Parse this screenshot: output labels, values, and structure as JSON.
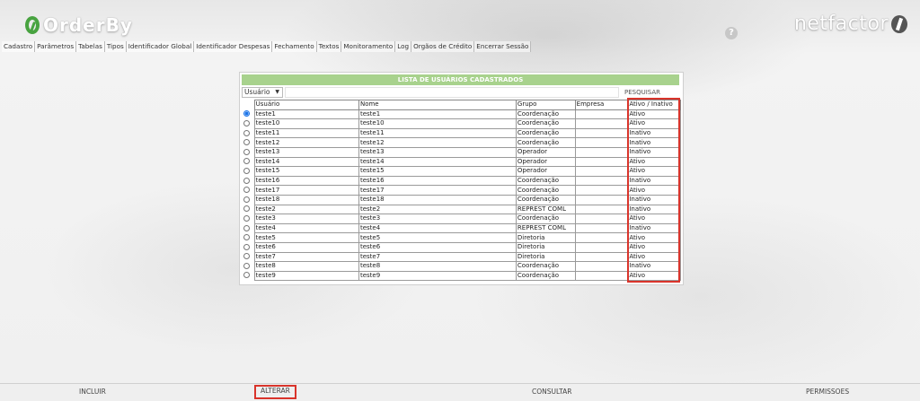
{
  "header": {
    "logo_left": "OrderBy",
    "logo_right": "netfactor",
    "help_glyph": "?"
  },
  "menu": [
    "Cadastro",
    "Parâmetros",
    "Tabelas",
    "Tipos",
    "Identificador Global",
    "Identificador Despesas",
    "Fechamento",
    "Textos",
    "Monitoramento",
    "Log",
    "Orgãos de Crédito",
    "Encerrar Sessão"
  ],
  "panel": {
    "title": "LISTA DE USUÁRIOS CADASTRADOS",
    "search": {
      "field_selected": "Usuário",
      "input_value": "",
      "button_label": "PESQUISAR"
    },
    "columns": [
      "Usuário",
      "Nome",
      "Grupo",
      "Empresa",
      "Ativo / Inativo"
    ],
    "rows": [
      {
        "usuario": "teste1",
        "nome": "teste1",
        "grupo": "Coordenação",
        "empresa": "",
        "status": "Ativo",
        "selected": true
      },
      {
        "usuario": "teste10",
        "nome": "teste10",
        "grupo": "Coordenação",
        "empresa": "",
        "status": "Ativo",
        "selected": false
      },
      {
        "usuario": "teste11",
        "nome": "teste11",
        "grupo": "Coordenação",
        "empresa": "",
        "status": "Inativo",
        "selected": false
      },
      {
        "usuario": "teste12",
        "nome": "teste12",
        "grupo": "Coordenação",
        "empresa": "",
        "status": "Inativo",
        "selected": false
      },
      {
        "usuario": "teste13",
        "nome": "teste13",
        "grupo": "Operador",
        "empresa": "",
        "status": "Inativo",
        "selected": false
      },
      {
        "usuario": "teste14",
        "nome": "teste14",
        "grupo": "Operador",
        "empresa": "",
        "status": "Ativo",
        "selected": false
      },
      {
        "usuario": "teste15",
        "nome": "teste15",
        "grupo": "Operador",
        "empresa": "",
        "status": "Ativo",
        "selected": false
      },
      {
        "usuario": "teste16",
        "nome": "teste16",
        "grupo": "Coordenação",
        "empresa": "",
        "status": "Inativo",
        "selected": false
      },
      {
        "usuario": "teste17",
        "nome": "teste17",
        "grupo": "Coordenação",
        "empresa": "",
        "status": "Ativo",
        "selected": false
      },
      {
        "usuario": "teste18",
        "nome": "teste18",
        "grupo": "Coordenação",
        "empresa": "",
        "status": "Inativo",
        "selected": false
      },
      {
        "usuario": "teste2",
        "nome": "teste2",
        "grupo": "REPREST COML",
        "empresa": "",
        "status": "Inativo",
        "selected": false
      },
      {
        "usuario": "teste3",
        "nome": "teste3",
        "grupo": "Coordenação",
        "empresa": "",
        "status": "Ativo",
        "selected": false
      },
      {
        "usuario": "teste4",
        "nome": "teste4",
        "grupo": "REPREST COML",
        "empresa": "",
        "status": "Inativo",
        "selected": false
      },
      {
        "usuario": "teste5",
        "nome": "teste5",
        "grupo": "Diretoria",
        "empresa": "",
        "status": "Ativo",
        "selected": false
      },
      {
        "usuario": "teste6",
        "nome": "teste6",
        "grupo": "Diretoria",
        "empresa": "",
        "status": "Ativo",
        "selected": false
      },
      {
        "usuario": "teste7",
        "nome": "teste7",
        "grupo": "Diretoria",
        "empresa": "",
        "status": "Ativo",
        "selected": false
      },
      {
        "usuario": "teste8",
        "nome": "teste8",
        "grupo": "Coordenação",
        "empresa": "",
        "status": "Inativo",
        "selected": false
      },
      {
        "usuario": "teste9",
        "nome": "teste9",
        "grupo": "Coordenação",
        "empresa": "",
        "status": "Ativo",
        "selected": false
      }
    ]
  },
  "footer": {
    "incluir": "INCLUIR",
    "alterar": "ALTERAR",
    "consultar": "CONSULTAR",
    "permissoes": "PERMISSOES"
  },
  "colors": {
    "title_bar": "#a8d28d",
    "highlight": "#d9342b",
    "logo_green": "#48a340"
  }
}
